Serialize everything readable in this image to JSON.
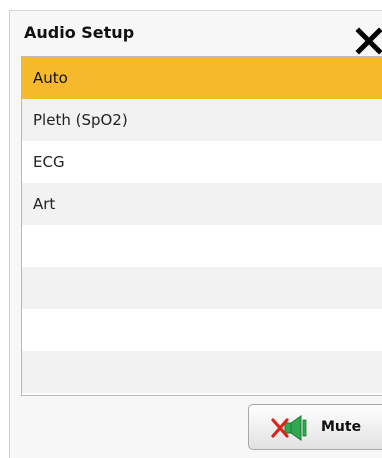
{
  "dialog": {
    "title": "Audio Setup",
    "close_icon": "close-icon"
  },
  "audio_sources": [
    {
      "label": "Auto",
      "selected": true
    },
    {
      "label": "Pleth (SpO2)",
      "selected": false
    },
    {
      "label": "ECG",
      "selected": false
    },
    {
      "label": "Art",
      "selected": false
    },
    {
      "label": "",
      "selected": false
    },
    {
      "label": "",
      "selected": false
    },
    {
      "label": "",
      "selected": false
    },
    {
      "label": "",
      "selected": false
    }
  ],
  "mute_button": {
    "label": "Mute",
    "icon": "speaker-muted-icon"
  },
  "colors": {
    "selected_row": "#f6b92c",
    "alt_row": "#f2f2f2",
    "mute_x": "#d9261c",
    "speaker": "#2fa84f"
  }
}
